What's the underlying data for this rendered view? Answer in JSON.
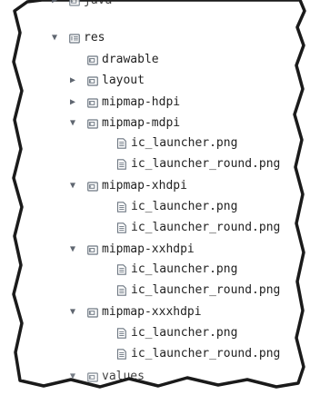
{
  "colors": {
    "paper": "#ffffff",
    "background": "#ffffff",
    "torn_edge": "#1a1a1a",
    "text": "#222222",
    "icon_stroke": "#6d7782"
  },
  "tree": {
    "items": [
      {
        "label": "java",
        "depth": 1,
        "toggle": "collapsed",
        "icon": "folder-icon",
        "partial": true
      },
      {
        "label": "res",
        "depth": 1,
        "toggle": "expanded",
        "icon": "resource-folder-icon"
      },
      {
        "label": "drawable",
        "depth": 2,
        "toggle": "none",
        "icon": "folder-icon"
      },
      {
        "label": "layout",
        "depth": 2,
        "toggle": "collapsed",
        "icon": "folder-icon"
      },
      {
        "label": "mipmap-hdpi",
        "depth": 2,
        "toggle": "collapsed",
        "icon": "folder-icon"
      },
      {
        "label": "mipmap-mdpi",
        "depth": 2,
        "toggle": "expanded",
        "icon": "folder-icon"
      },
      {
        "label": "ic_launcher.png",
        "depth": 3,
        "toggle": "none",
        "icon": "image-file-icon"
      },
      {
        "label": "ic_launcher_round.png",
        "depth": 3,
        "toggle": "none",
        "icon": "image-file-icon"
      },
      {
        "label": "mipmap-xhdpi",
        "depth": 2,
        "toggle": "expanded",
        "icon": "folder-icon"
      },
      {
        "label": "ic_launcher.png",
        "depth": 3,
        "toggle": "none",
        "icon": "image-file-icon"
      },
      {
        "label": "ic_launcher_round.png",
        "depth": 3,
        "toggle": "none",
        "icon": "image-file-icon"
      },
      {
        "label": "mipmap-xxhdpi",
        "depth": 2,
        "toggle": "expanded",
        "icon": "folder-icon"
      },
      {
        "label": "ic_launcher.png",
        "depth": 3,
        "toggle": "none",
        "icon": "image-file-icon"
      },
      {
        "label": "ic_launcher_round.png",
        "depth": 3,
        "toggle": "none",
        "icon": "image-file-icon"
      },
      {
        "label": "mipmap-xxxhdpi",
        "depth": 2,
        "toggle": "expanded",
        "icon": "folder-icon"
      },
      {
        "label": "ic_launcher.png",
        "depth": 3,
        "toggle": "none",
        "icon": "image-file-icon"
      },
      {
        "label": "ic_launcher_round.png",
        "depth": 3,
        "toggle": "none",
        "icon": "image-file-icon"
      },
      {
        "label": "values",
        "depth": 2,
        "toggle": "expanded",
        "icon": "folder-icon",
        "partial": true
      }
    ]
  }
}
